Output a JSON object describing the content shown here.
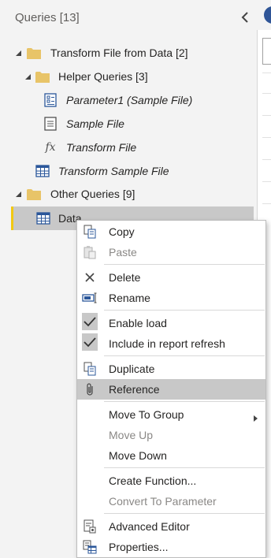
{
  "queries_pane": {
    "title": "Queries [13]",
    "tree": [
      {
        "label": "Transform File from Data [2]",
        "type": "group",
        "expanded": true,
        "icon": "folder-icon"
      },
      {
        "label": "Helper Queries [3]",
        "type": "group",
        "expanded": true,
        "icon": "folder-icon"
      },
      {
        "label": "Parameter1 (Sample File)",
        "type": "parameter",
        "icon": "parameter-icon"
      },
      {
        "label": "Sample File",
        "type": "query",
        "icon": "document-icon"
      },
      {
        "label": "Transform File",
        "type": "function",
        "icon": "function-icon"
      },
      {
        "label": "Transform Sample File",
        "type": "table",
        "icon": "table-icon"
      },
      {
        "label": "Other Queries [9]",
        "type": "group",
        "expanded": true,
        "icon": "folder-icon"
      },
      {
        "label": "Data",
        "type": "table",
        "icon": "table-icon",
        "selected": true
      }
    ]
  },
  "context_menu": {
    "items": [
      {
        "label": "Copy",
        "icon": "copy-icon",
        "enabled": true
      },
      {
        "label": "Paste",
        "icon": "paste-icon",
        "enabled": false
      },
      {
        "label": "Delete",
        "icon": "delete-icon",
        "enabled": true
      },
      {
        "label": "Rename",
        "icon": "rename-icon",
        "enabled": true
      },
      {
        "label": "Enable load",
        "icon": "checkmark-icon",
        "enabled": true,
        "checked": true
      },
      {
        "label": "Include in report refresh",
        "icon": "checkmark-icon",
        "enabled": true,
        "checked": true
      },
      {
        "label": "Duplicate",
        "icon": "duplicate-icon",
        "enabled": true
      },
      {
        "label": "Reference",
        "icon": "paperclip-icon",
        "enabled": true,
        "hovered": true
      },
      {
        "label": "Move To Group",
        "icon": "",
        "enabled": true,
        "submenu": true
      },
      {
        "label": "Move Up",
        "icon": "",
        "enabled": false
      },
      {
        "label": "Move Down",
        "icon": "",
        "enabled": true
      },
      {
        "label": "Create Function...",
        "icon": "",
        "enabled": true
      },
      {
        "label": "Convert To Parameter",
        "icon": "",
        "enabled": false
      },
      {
        "label": "Advanced Editor",
        "icon": "advanced-editor-icon",
        "enabled": true
      },
      {
        "label": "Properties...",
        "icon": "properties-icon",
        "enabled": true
      }
    ]
  },
  "colors": {
    "accent": "#f2c811",
    "folder": "#e8c468",
    "icon_blue": "#2b579a",
    "selected_bg": "#c8c8c8"
  }
}
